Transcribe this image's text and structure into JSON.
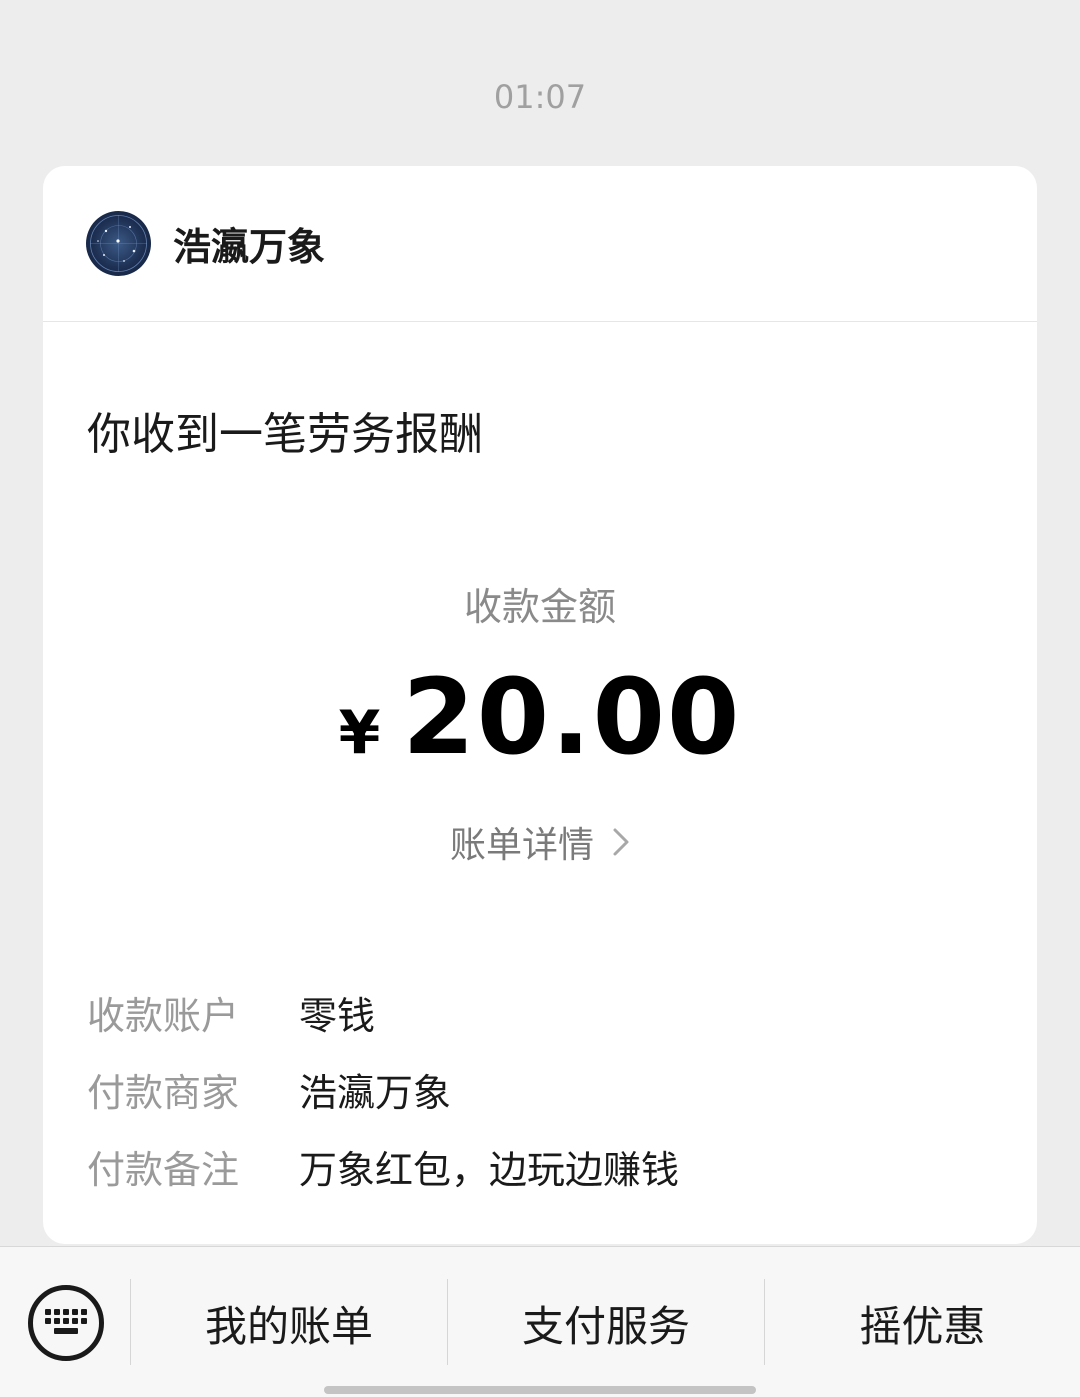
{
  "timestamp": "01:07",
  "card": {
    "merchant_name": "浩瀛万象",
    "notice_title": "你收到一笔劳务报酬",
    "amount_label": "收款金额",
    "currency_symbol": "¥",
    "amount_value": "20.00",
    "bill_link": "账单详情",
    "details": [
      {
        "key": "收款账户",
        "value": "零钱"
      },
      {
        "key": "付款商家",
        "value": "浩瀛万象"
      },
      {
        "key": "付款备注",
        "value": "万象红包，边玩边赚钱"
      }
    ]
  },
  "bottom_menu": {
    "keyboard_icon": "keyboard-icon",
    "items": [
      {
        "label": "我的账单"
      },
      {
        "label": "支付服务"
      },
      {
        "label": "摇优惠"
      }
    ]
  },
  "colors": {
    "background": "#ededed",
    "card": "#ffffff",
    "primary_text": "#1a1a1a",
    "secondary_text": "#9a9a9a"
  }
}
